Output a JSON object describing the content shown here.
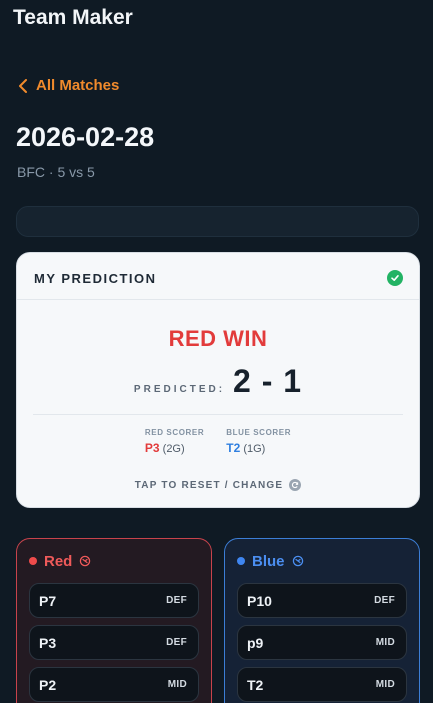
{
  "app": {
    "title": "Team Maker"
  },
  "nav": {
    "back_label": "All Matches"
  },
  "match": {
    "date": "2026-02-28",
    "subtitle": "BFC · 5 vs 5",
    "progress": 0
  },
  "prediction": {
    "header": "MY PREDICTION",
    "outcome": "RED WIN",
    "predicted_label": "PREDICTED:",
    "score": "2 - 1",
    "red_scorer": {
      "label": "RED SCORER",
      "player": "P3",
      "goals": "(2G)"
    },
    "blue_scorer": {
      "label": "BLUE SCORER",
      "player": "T2",
      "goals": "(1G)"
    },
    "reset_label": "TAP TO RESET / CHANGE"
  },
  "teams": {
    "red": {
      "name": "Red",
      "color": "#ef4b4b",
      "players": [
        {
          "name": "P7",
          "pos": "DEF"
        },
        {
          "name": "P3",
          "pos": "DEF"
        },
        {
          "name": "P2",
          "pos": "MID"
        }
      ]
    },
    "blue": {
      "name": "Blue",
      "color": "#3f86f0",
      "players": [
        {
          "name": "P10",
          "pos": "DEF"
        },
        {
          "name": "p9",
          "pos": "MID"
        },
        {
          "name": "T2",
          "pos": "MID"
        }
      ]
    }
  },
  "colors": {
    "accent": "#f08a2c",
    "success": "#22b364",
    "background": "#0f1a24"
  }
}
